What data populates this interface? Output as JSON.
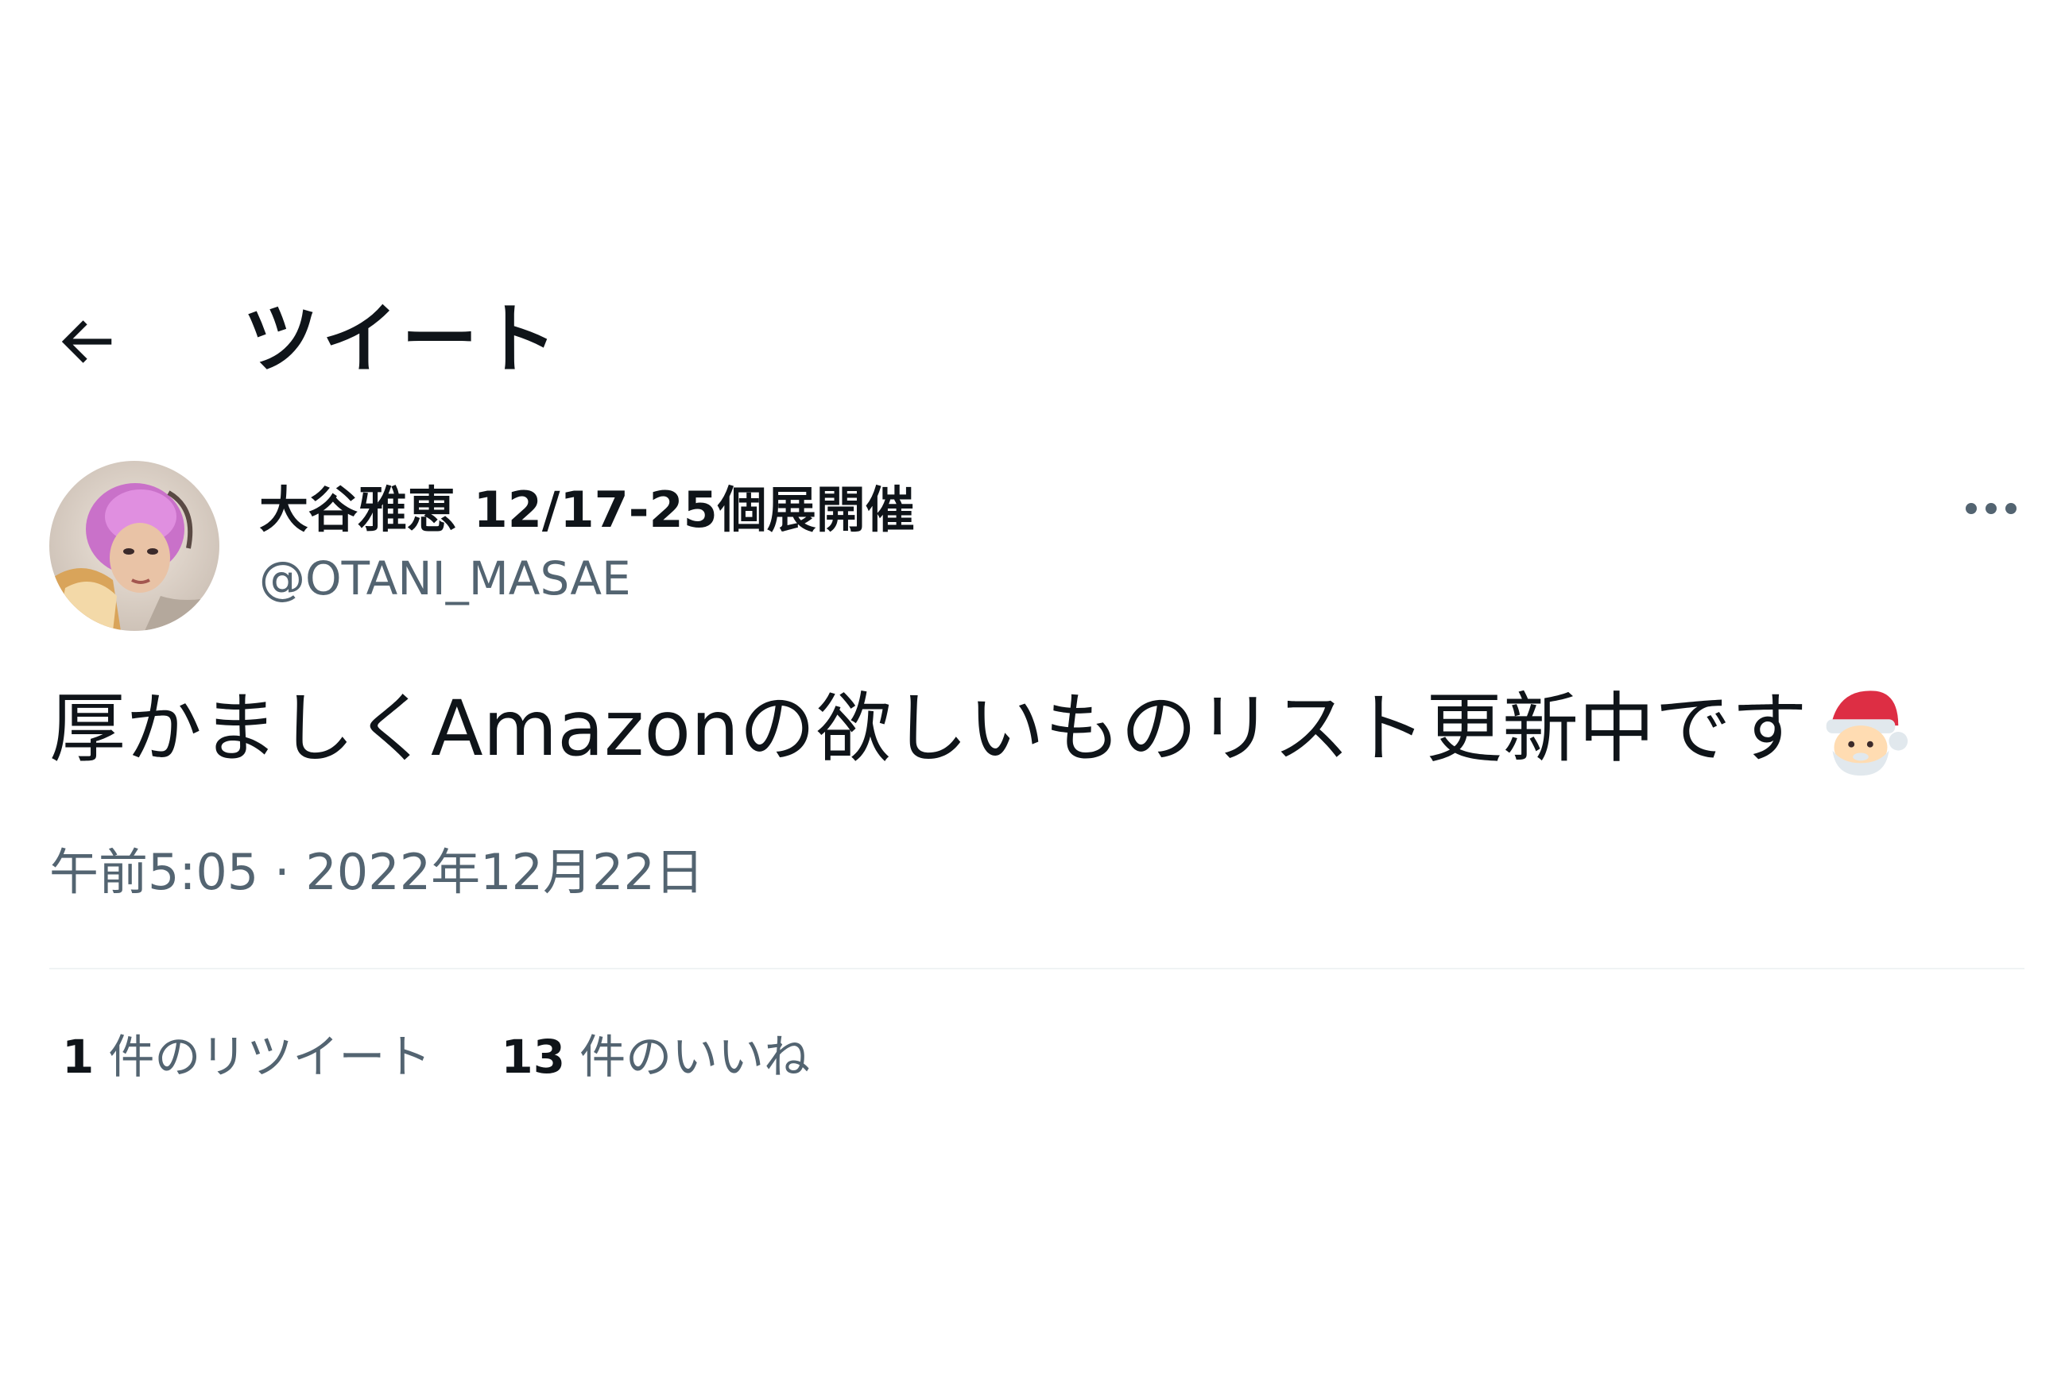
{
  "header": {
    "back_icon": "arrow-left-icon",
    "title": "ツイート"
  },
  "tweet": {
    "author": {
      "display_name": "大谷雅恵 12/17-25個展開催",
      "handle": "@OTANI_MASAE"
    },
    "more_icon": "more-dots-icon",
    "text": "厚かましくAmazonの欲しいものリスト更新中です",
    "emoji": "santa-emoji",
    "time": "午前5:05",
    "separator": " · ",
    "date": "2022年12月22日",
    "stats": {
      "retweets_count": "1",
      "retweets_label": "件のリツイート",
      "likes_count": "13",
      "likes_label": "件のいいね"
    }
  },
  "colors": {
    "text_primary": "#0f1419",
    "text_secondary": "#536471",
    "divider": "#eff3f4",
    "background": "#ffffff"
  }
}
